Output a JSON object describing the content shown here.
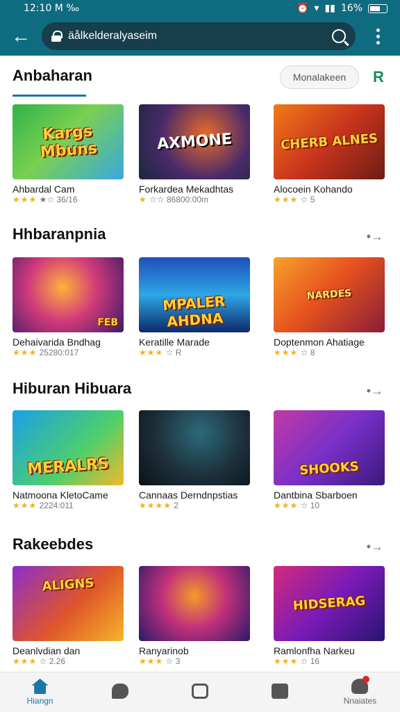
{
  "status": {
    "time": "12:10 M ‰",
    "battery": "16%"
  },
  "browser": {
    "url": "äålkelderalyaseim"
  },
  "colors": {
    "toolbar": "#0f6b80",
    "accent": "#1677a8",
    "star": "#f2b01e"
  },
  "filter": {
    "label": "Monalakeen",
    "icon": "R"
  },
  "sections": [
    {
      "title": "Anbaharan",
      "cards": [
        {
          "name": "Ahbardal Cam",
          "stars": "★★★",
          "meta": "★☆ 36/16",
          "art": "Kargs Mbuns"
        },
        {
          "name": "Forkardea Mekadhtas",
          "stars": "★",
          "meta": "☆☆ 86800:00m",
          "art": "AXMONE"
        },
        {
          "name": "Alocoein Kohando",
          "stars": "★★★",
          "meta": "☆ 5",
          "art": "CHERB ALNES"
        }
      ]
    },
    {
      "title": "Hhbaranpnia",
      "more": "•→",
      "cards": [
        {
          "name": "Dehaivarida Bndhag",
          "stars": "★★★",
          "meta": "25280:017",
          "art": "FEB"
        },
        {
          "name": "Keratille Marade",
          "stars": "★★★",
          "meta": "☆ R",
          "art": "MPALER AHDNA"
        },
        {
          "name": "Doptenmon Ahatiage",
          "stars": "★★★",
          "meta": "☆ 8",
          "art": "NARDES"
        }
      ]
    },
    {
      "title": "Hiburan Hibuara",
      "more": "•→",
      "cards": [
        {
          "name": "Natmoona KletoCame",
          "stars": "★★★",
          "meta": "2224:011",
          "art": "MERALRS"
        },
        {
          "name": "Cannaas Derndnpstias",
          "stars": "★★★★",
          "meta": "2",
          "art": ""
        },
        {
          "name": "Dantbina Sbarboen",
          "stars": "★★★",
          "meta": "☆ 10",
          "art": "SHOOKS"
        }
      ]
    },
    {
      "title": "Rakeebdes",
      "more": "•→",
      "cards": [
        {
          "name": "Deanlvdian dan",
          "stars": "★★★",
          "meta": "☆ 2.26",
          "art": "ALIGNS"
        },
        {
          "name": "Ranyarinob",
          "stars": "★★★",
          "meta": "☆ 3",
          "art": ""
        },
        {
          "name": "Ramlonfha Narkeu",
          "stars": "★★★",
          "meta": "☆ 16",
          "art": "HIDSERAG"
        }
      ]
    }
  ],
  "nav": [
    {
      "label": "Hiangn",
      "icon": "home-icon"
    },
    {
      "label": "",
      "icon": "chat-icon"
    },
    {
      "label": "",
      "icon": "camera-icon"
    },
    {
      "label": "",
      "icon": "wallet-icon"
    },
    {
      "label": "Nnaiates",
      "icon": "profile-icon"
    }
  ]
}
